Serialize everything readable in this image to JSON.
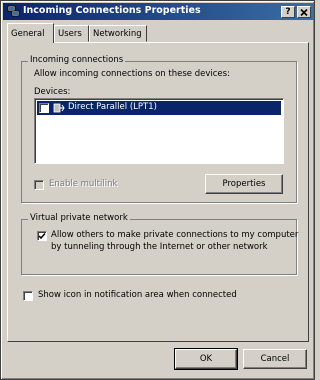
{
  "window": {
    "title": "Incoming Connections Properties",
    "help_btn": "?",
    "close_btn": "X"
  },
  "tabs": [
    {
      "label": "General"
    },
    {
      "label": "Users"
    },
    {
      "label": "Networking"
    }
  ],
  "incoming": {
    "group_label": "Incoming connections",
    "allow_text": "Allow incoming connections on these devices:",
    "devices_label": "Devices:",
    "devices": [
      {
        "label": "Direct Parallel (LPT1)",
        "checked": false,
        "selected": true
      }
    ],
    "multilink_label": "Enable multilink",
    "properties_btn": "Properties"
  },
  "vpn": {
    "group_label": "Virtual private network",
    "allow_text_line1": "Allow others to make private connections to my computer",
    "allow_text_line2": "by tunneling through the Internet or other network",
    "checked": true
  },
  "notify": {
    "label": "Show icon in notification area when connected",
    "checked": false
  },
  "buttons": {
    "ok": "OK",
    "cancel": "Cancel"
  },
  "colors": {
    "title_bar": "#0a246a",
    "face": "#d4d0c8",
    "selection": "#0a246a"
  }
}
